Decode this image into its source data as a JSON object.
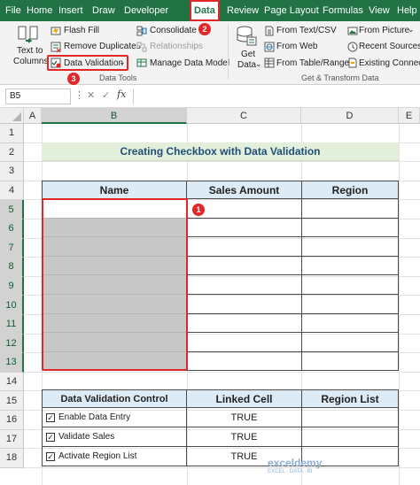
{
  "menu": {
    "items": [
      "File",
      "Home",
      "Insert",
      "Draw",
      "Developer",
      "Data",
      "Review",
      "Page Layout",
      "Formulas",
      "View",
      "Help"
    ],
    "active": "Data"
  },
  "ribbon": {
    "text_to_columns": [
      "Text to",
      "Columns"
    ],
    "flash_fill": "Flash Fill",
    "remove_duplicates": "Remove Duplicates",
    "data_validation": "Data Validation",
    "consolidate": "Consolidate",
    "relationships": "Relationships",
    "manage_data_model": "Manage Data Model",
    "get_data": [
      "Get",
      "Data"
    ],
    "from_text_csv": "From Text/CSV",
    "from_web": "From Web",
    "from_table_range": "From Table/Range",
    "from_picture": "From Picture",
    "recent_sources": "Recent Sources",
    "existing_connections": "Existing Connecti",
    "group_data_tools": "Data Tools",
    "group_get_transform": "Get & Transform Data"
  },
  "steps": [
    "1",
    "2",
    "3"
  ],
  "formula_bar": {
    "name_box": "B5",
    "fx": "fx",
    "formula": ""
  },
  "columns": [
    "A",
    "B",
    "C",
    "D",
    "E"
  ],
  "selected_column": "B",
  "rows": [
    "1",
    "2",
    "3",
    "4",
    "5",
    "6",
    "7",
    "8",
    "9",
    "10",
    "11",
    "12",
    "13",
    "14",
    "15",
    "16",
    "17",
    "18"
  ],
  "sheet": {
    "title": "Creating Checkbox with Data Validation",
    "table1": {
      "headers": [
        "Name",
        "Sales Amount",
        "Region"
      ]
    },
    "table2": {
      "headers": [
        "Data Validation Control",
        "Linked Cell",
        "Region List"
      ],
      "rows": [
        {
          "label": "Enable Data Entry",
          "checked": true,
          "linked": "TRUE"
        },
        {
          "label": "Validate Sales",
          "checked": true,
          "linked": "TRUE"
        },
        {
          "label": "Activate Region List",
          "checked": true,
          "linked": "TRUE"
        }
      ]
    }
  },
  "watermark": {
    "brand": "exceldemy",
    "tagline": "EXCEL · DATA · BI"
  },
  "colors": {
    "excel_green": "#217346",
    "title_bg": "#e2efda",
    "header_bg": "#ddebf7",
    "highlight_red": "#e32626",
    "gray_cells": "#c8c8c8"
  }
}
